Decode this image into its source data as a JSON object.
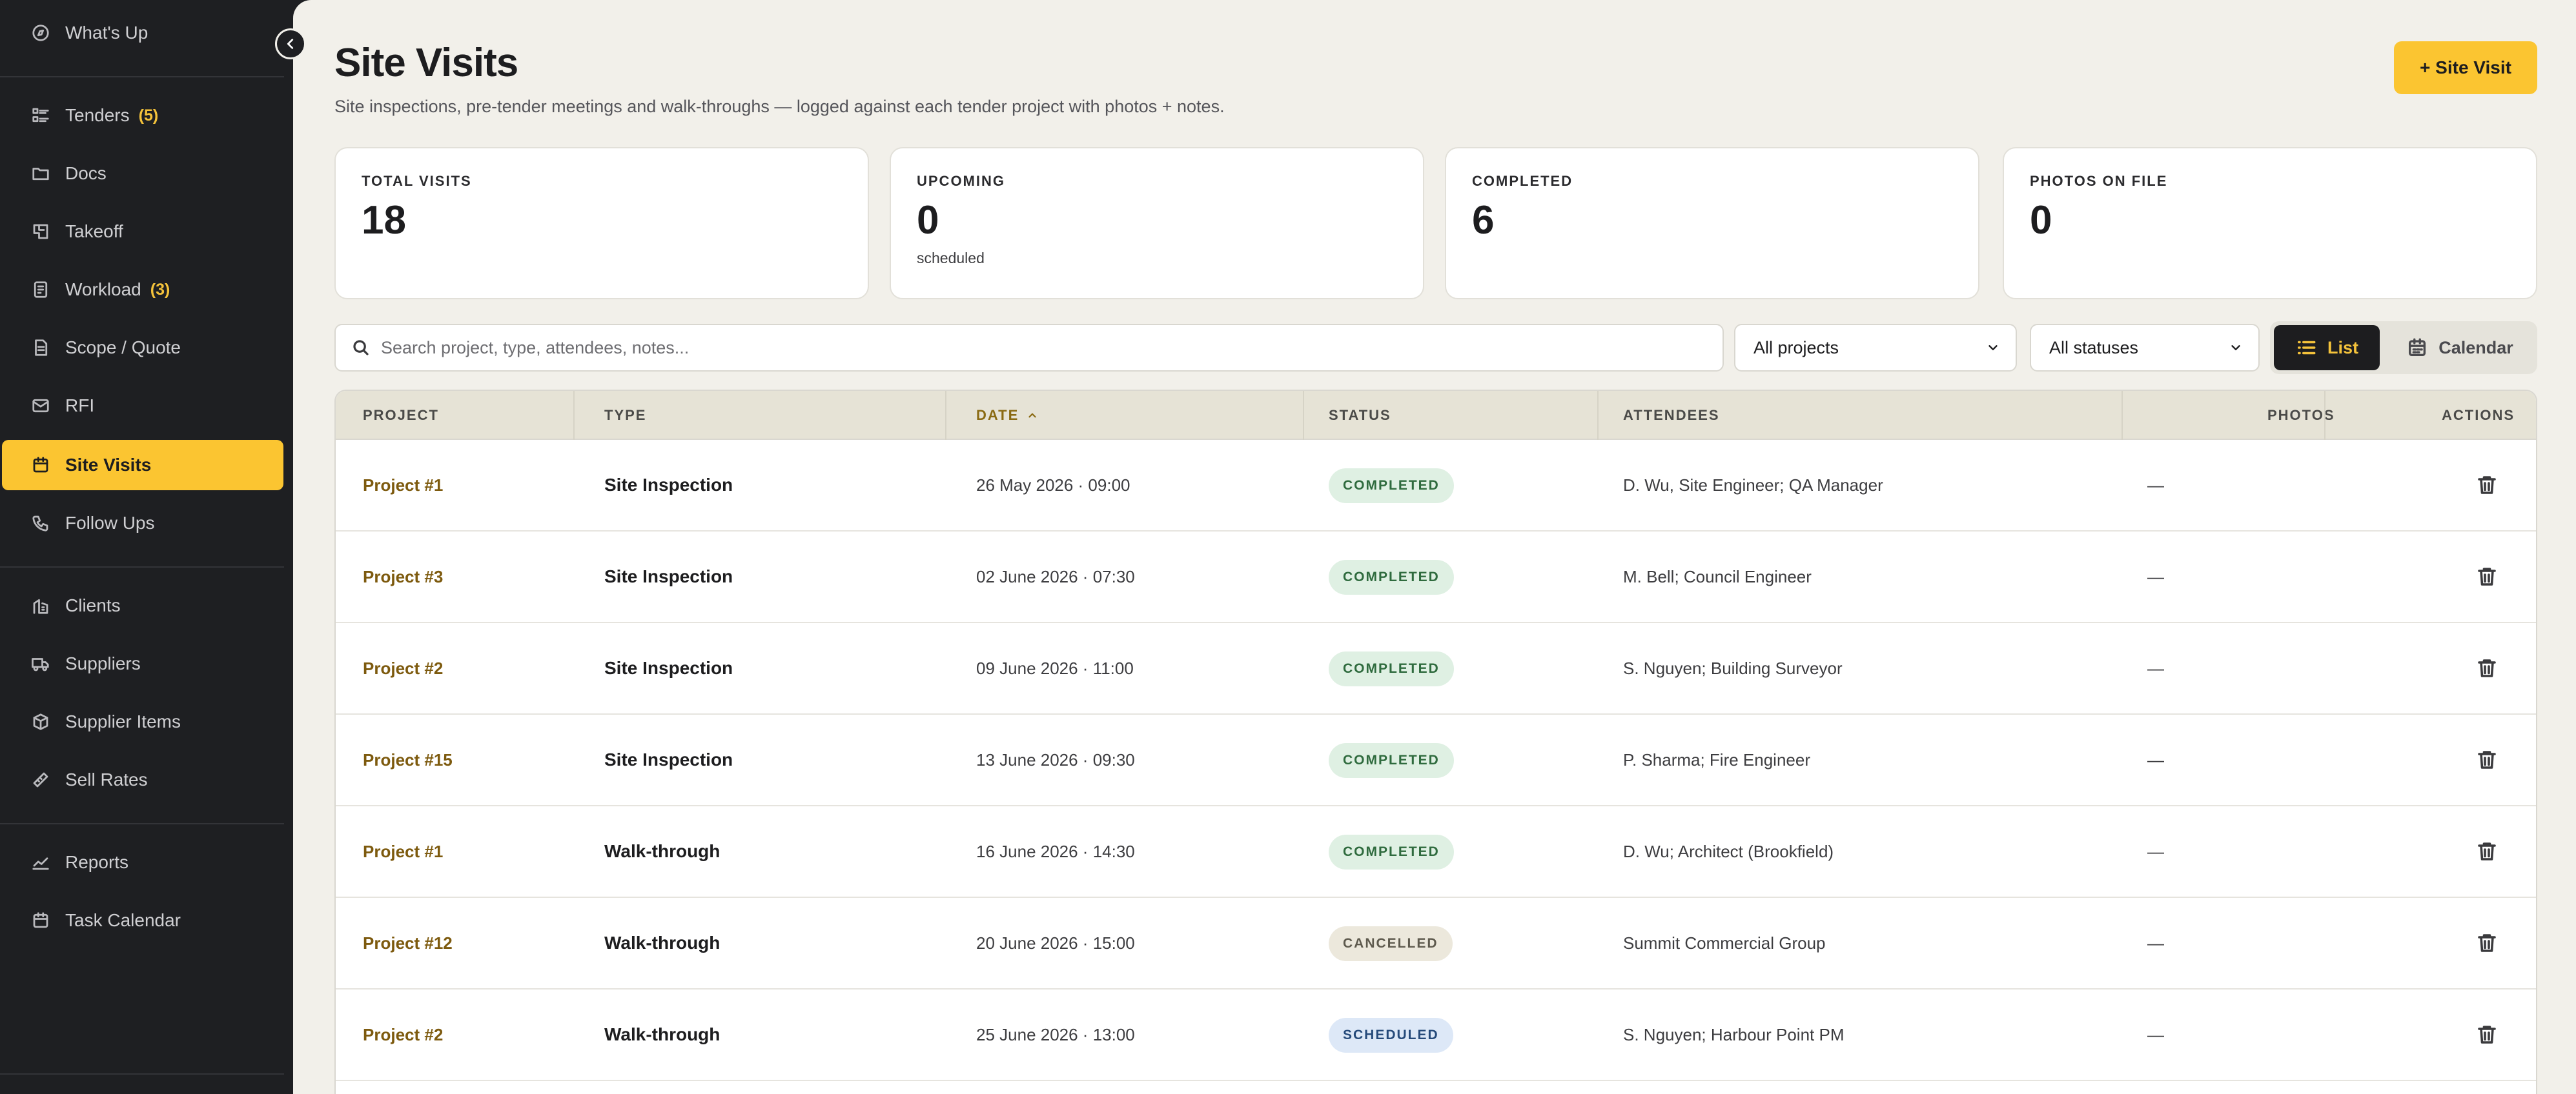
{
  "sidebar": {
    "items": [
      {
        "label": "What's Up",
        "icon": "compass-icon"
      },
      {
        "label": "Tenders",
        "count": "(5)",
        "icon": "list-icon"
      },
      {
        "label": "Docs",
        "icon": "folder-icon"
      },
      {
        "label": "Takeoff",
        "icon": "blueprint-icon"
      },
      {
        "label": "Workload",
        "count": "(3)",
        "icon": "clipboard-icon"
      },
      {
        "label": "Scope / Quote",
        "icon": "document-icon"
      },
      {
        "label": "RFI",
        "icon": "mail-icon"
      },
      {
        "label": "Site Visits",
        "icon": "calendar-icon",
        "active": true
      },
      {
        "label": "Follow Ups",
        "icon": "phone-icon"
      },
      {
        "label": "Clients",
        "icon": "building-icon"
      },
      {
        "label": "Suppliers",
        "icon": "truck-icon"
      },
      {
        "label": "Supplier Items",
        "icon": "box-icon"
      },
      {
        "label": "Sell Rates",
        "icon": "tag-icon"
      },
      {
        "label": "Reports",
        "icon": "chart-line-icon"
      },
      {
        "label": "Task Calendar",
        "icon": "calendar-icon"
      }
    ]
  },
  "header": {
    "title": "Site Visits",
    "subtitle": "Site inspections, pre-tender meetings and walk-throughs — logged against each tender project with photos + notes.",
    "add_button": "+ Site Visit"
  },
  "stats": [
    {
      "label": "TOTAL VISITS",
      "value": "18",
      "sub": ""
    },
    {
      "label": "UPCOMING",
      "value": "0",
      "sub": "scheduled"
    },
    {
      "label": "COMPLETED",
      "value": "6",
      "sub": ""
    },
    {
      "label": "PHOTOS ON FILE",
      "value": "0",
      "sub": ""
    }
  ],
  "filters": {
    "search_placeholder": "Search project, type, attendees, notes...",
    "project_select": "All projects",
    "status_select": "All statuses",
    "view_list": "List",
    "view_calendar": "Calendar"
  },
  "table": {
    "columns": [
      "PROJECT",
      "TYPE",
      "DATE",
      "STATUS",
      "ATTENDEES",
      "PHOTOS",
      "ACTIONS"
    ],
    "rows": [
      {
        "project": "Project #1",
        "type": "Site Inspection",
        "date": "26 May 2026 · 09:00",
        "status": "COMPLETED",
        "attendees": "D. Wu, Site Engineer; QA Manager",
        "photos": "—"
      },
      {
        "project": "Project #3",
        "type": "Site Inspection",
        "date": "02 June 2026 · 07:30",
        "status": "COMPLETED",
        "attendees": "M. Bell; Council Engineer",
        "photos": "—"
      },
      {
        "project": "Project #2",
        "type": "Site Inspection",
        "date": "09 June 2026 · 11:00",
        "status": "COMPLETED",
        "attendees": "S. Nguyen; Building Surveyor",
        "photos": "—"
      },
      {
        "project": "Project #15",
        "type": "Site Inspection",
        "date": "13 June 2026 · 09:30",
        "status": "COMPLETED",
        "attendees": "P. Sharma; Fire Engineer",
        "photos": "—"
      },
      {
        "project": "Project #1",
        "type": "Walk-through",
        "date": "16 June 2026 · 14:30",
        "status": "COMPLETED",
        "attendees": "D. Wu; Architect (Brookfield)",
        "photos": "—"
      },
      {
        "project": "Project #12",
        "type": "Walk-through",
        "date": "20 June 2026 · 15:00",
        "status": "CANCELLED",
        "attendees": "Summit Commercial Group",
        "photos": "—"
      },
      {
        "project": "Project #2",
        "type": "Walk-through",
        "date": "25 June 2026 · 13:00",
        "status": "SCHEDULED",
        "attendees": "S. Nguyen; Harbour Point PM",
        "photos": "—"
      }
    ]
  },
  "colors": {
    "accent": "#fbc531",
    "sidebar_bg": "#1e1f22",
    "main_bg": "#f2f0ea",
    "completed": "#dff0e3",
    "cancelled": "#ece8dc",
    "scheduled": "#dde8f7"
  }
}
